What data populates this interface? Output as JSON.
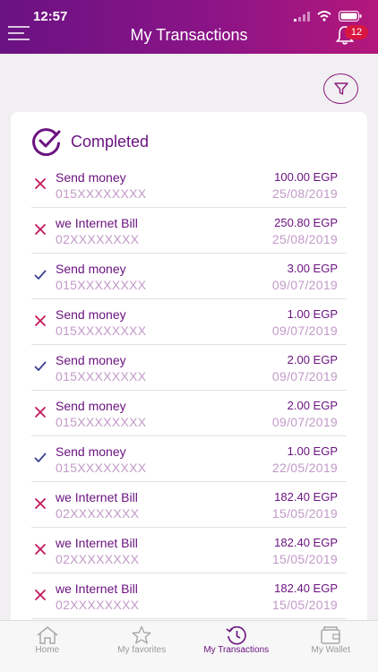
{
  "status_bar": {
    "time": "12:57"
  },
  "header": {
    "title": "My Transactions",
    "notification_count": "12"
  },
  "section": {
    "title": "Completed"
  },
  "transactions": [
    {
      "name": "Send money",
      "number": "015XXXXXXXX",
      "amount": "100.00 EGP",
      "date": "25/08/2019",
      "status": "failed"
    },
    {
      "name": "we Internet Bill",
      "number": "02XXXXXXXX",
      "amount": "250.80 EGP",
      "date": "25/08/2019",
      "status": "failed"
    },
    {
      "name": "Send money",
      "number": "015XXXXXXXX",
      "amount": "3.00 EGP",
      "date": "09/07/2019",
      "status": "success"
    },
    {
      "name": "Send money",
      "number": "015XXXXXXXX",
      "amount": "1.00 EGP",
      "date": "09/07/2019",
      "status": "failed"
    },
    {
      "name": "Send money",
      "number": "015XXXXXXXX",
      "amount": "2.00 EGP",
      "date": "09/07/2019",
      "status": "success"
    },
    {
      "name": "Send money",
      "number": "015XXXXXXXX",
      "amount": "2.00 EGP",
      "date": "09/07/2019",
      "status": "failed"
    },
    {
      "name": "Send money",
      "number": "015XXXXXXXX",
      "amount": "1.00 EGP",
      "date": "22/05/2019",
      "status": "success"
    },
    {
      "name": "we Internet Bill",
      "number": "02XXXXXXXX",
      "amount": "182.40 EGP",
      "date": "15/05/2019",
      "status": "failed"
    },
    {
      "name": "we Internet Bill",
      "number": "02XXXXXXXX",
      "amount": "182.40 EGP",
      "date": "15/05/2019",
      "status": "failed"
    },
    {
      "name": "we Internet Bill",
      "number": "02XXXXXXXX",
      "amount": "182.40 EGP",
      "date": "15/05/2019",
      "status": "failed"
    }
  ],
  "tabs": [
    {
      "label": "Home",
      "icon": "home-icon"
    },
    {
      "label": "My favorites",
      "icon": "star-icon"
    },
    {
      "label": "My Transactions",
      "icon": "history-icon",
      "active": true
    },
    {
      "label": "My Wallet",
      "icon": "wallet-icon"
    }
  ],
  "colors": {
    "brand": "#6b1480",
    "failed": "#c2185b",
    "success": "#3b3f8f",
    "badge": "#d8163f"
  }
}
